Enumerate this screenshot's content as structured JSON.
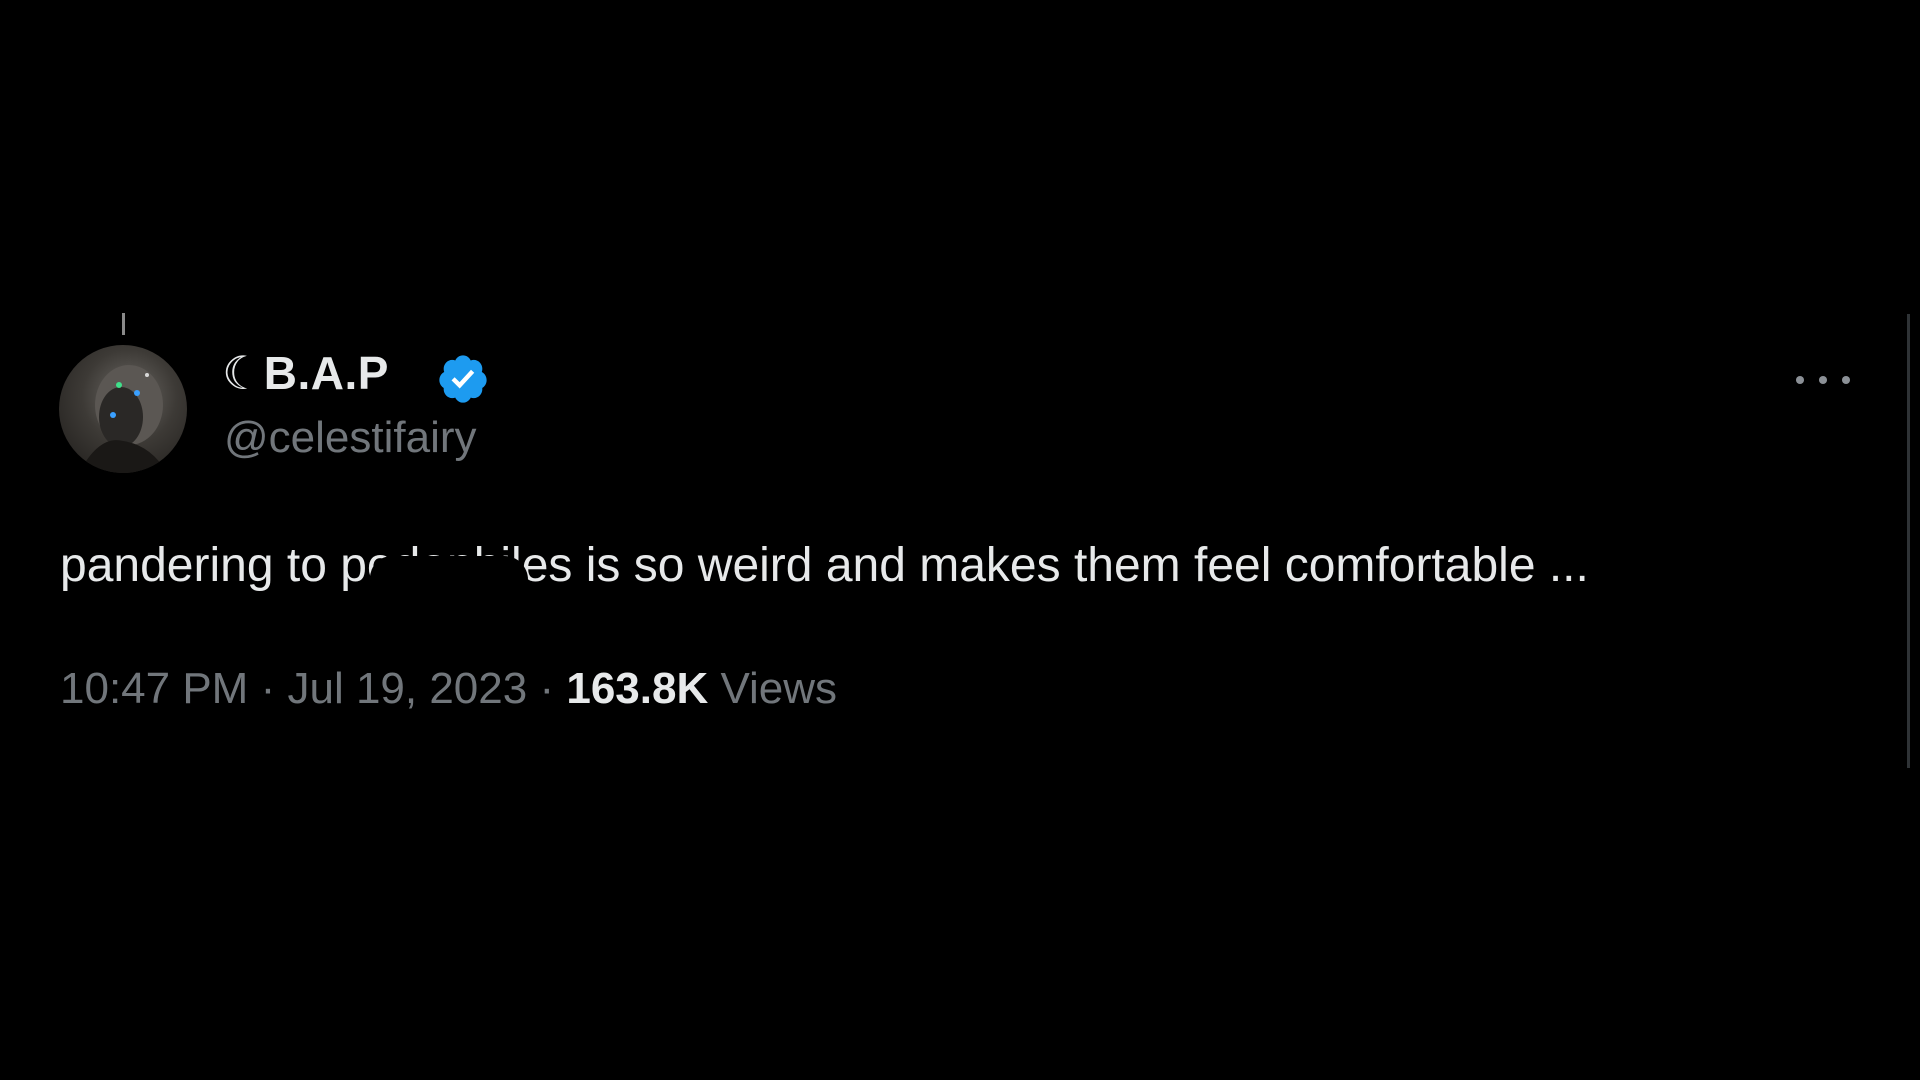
{
  "tweet": {
    "display_name": "☾B.A.P",
    "handle": "@celestifairy",
    "verified": true,
    "text": "pandering to pedophiles is so weird and makes them feel comfortable ...",
    "time": "10:47 PM",
    "separator": "·",
    "date": "Jul 19, 2023",
    "views_count": "163.8K",
    "views_label": "Views"
  },
  "icons": {
    "verified": "verified-badge-icon",
    "more": "more-options-icon"
  },
  "colors": {
    "background": "#000000",
    "primary_text": "#e7e9ea",
    "secondary_text": "#71767b",
    "verified_blue": "#1d9bf0"
  }
}
